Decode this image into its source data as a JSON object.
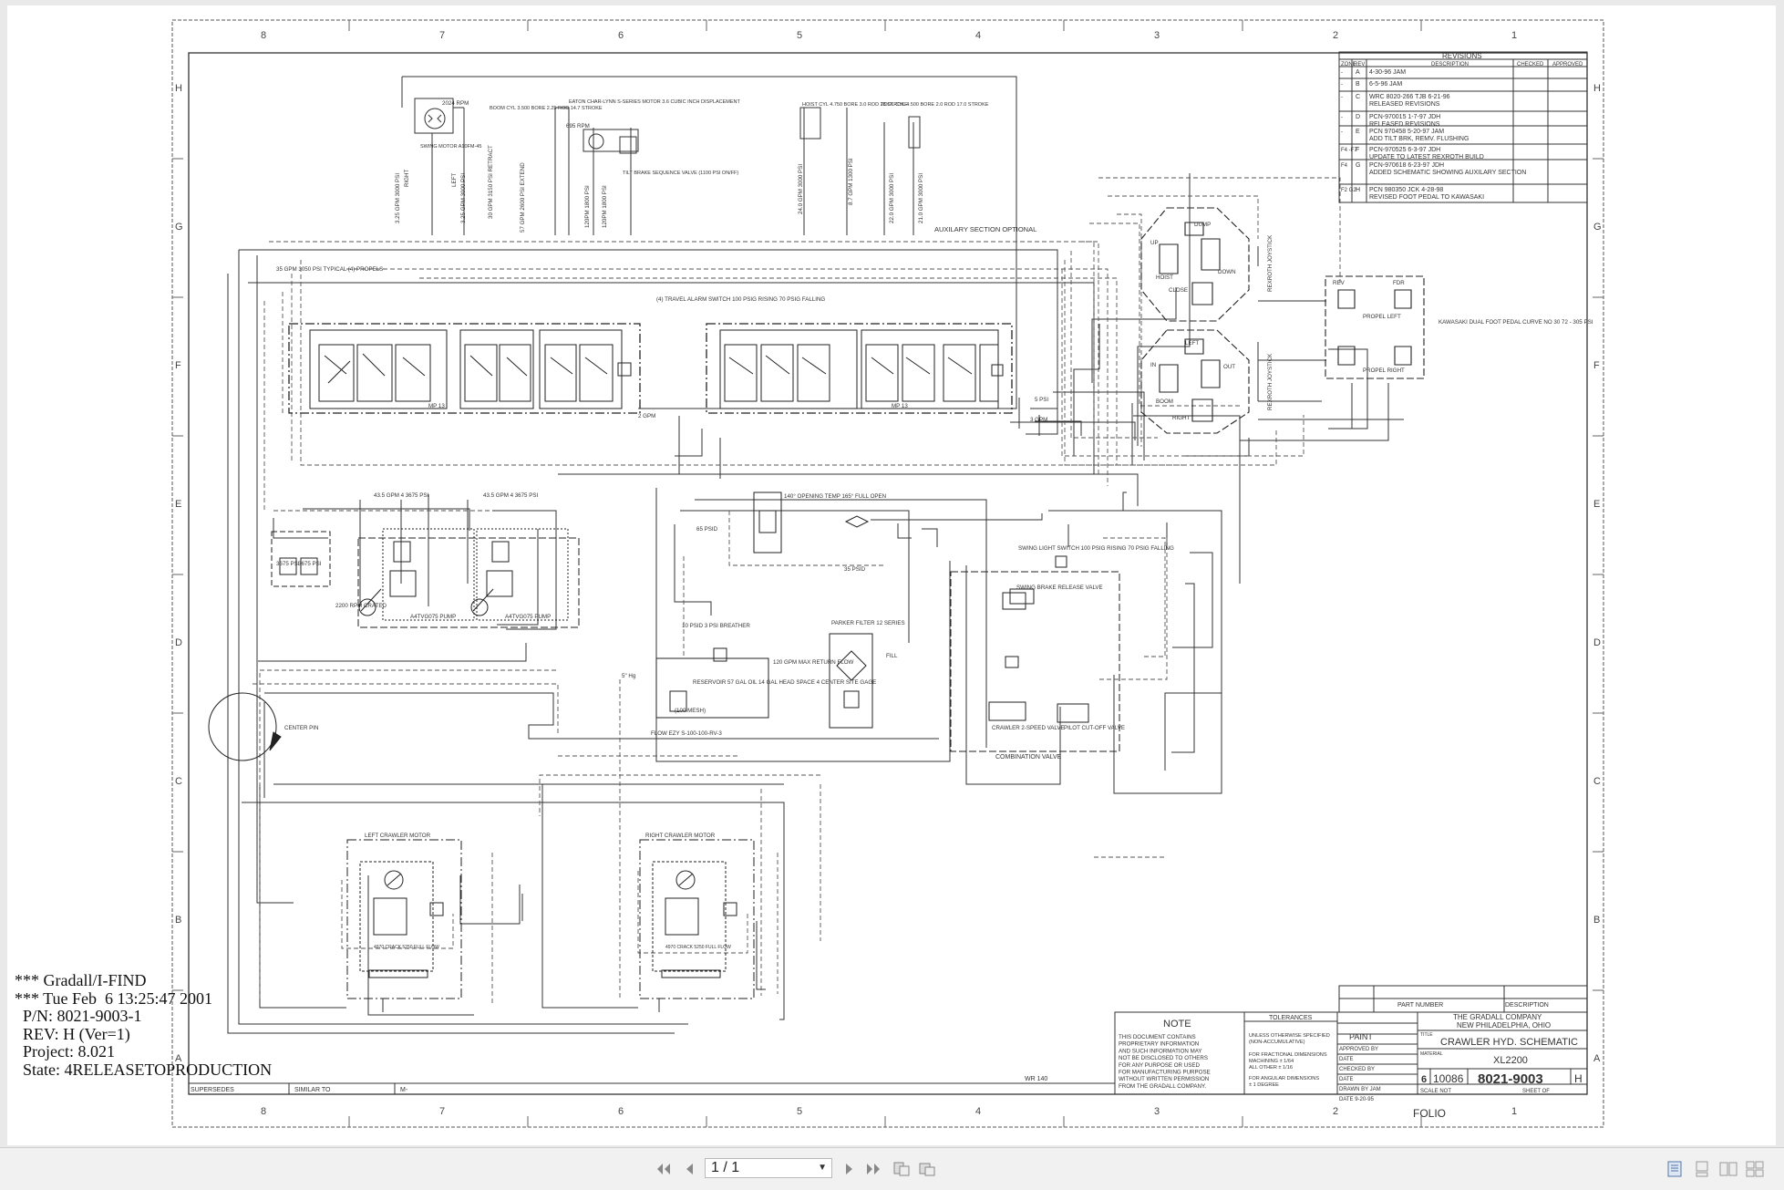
{
  "drawing": {
    "zone_numbers": [
      "8",
      "7",
      "6",
      "5",
      "4",
      "3",
      "2",
      "1"
    ],
    "zone_letters": [
      "H",
      "G",
      "F",
      "E",
      "D",
      "C",
      "B",
      "A"
    ],
    "revisions": {
      "title": "REVISIONS",
      "headers": [
        "ZONE",
        "REV",
        "DESCRIPTION",
        "CHECKED",
        "APPROVED"
      ],
      "rows": [
        {
          "zone": "-",
          "rev": "A",
          "desc1": "4-30-96   JAM",
          "desc2": ""
        },
        {
          "zone": "-",
          "rev": "B",
          "desc1": "6-5-96   JAM",
          "desc2": ""
        },
        {
          "zone": "-",
          "rev": "C",
          "desc1": "WRC 8020-266  TJB  6-21-96",
          "desc2": "RELEASED REVISIONS"
        },
        {
          "zone": "-",
          "rev": "D",
          "desc1": "PCN-970015  1-7-97  JDH",
          "desc2": "RELEASED REVISIONS"
        },
        {
          "zone": "-",
          "rev": "E",
          "desc1": "PCN 970458  5-20-97  JAM",
          "desc2": "ADD TILT BRK, REMV. FLUSHING"
        },
        {
          "zone": "F4 -F7",
          "rev": "F",
          "desc1": "PCN-970525  6-3-97  JDH",
          "desc2": "UPDATE TO LATEST REXROTH BUILD"
        },
        {
          "zone": "F4",
          "rev": "G",
          "desc1": "PCN-970618  6-23-97  JDH",
          "desc2": "ADDED SCHEMATIC SHOWING AUXILARY SECTION"
        },
        {
          "zone": "F2 G2",
          "rev": "H",
          "desc1": "PCN 980350    JCK  4-28-98",
          "desc2": "REVISED FOOT PEDAL TO KAWASAKI"
        }
      ]
    },
    "labels": {
      "rpm_2024": "2024 RPM",
      "swing_motor": "SWING MOTOR A10FM-45",
      "right": "RIGHT",
      "left": "LEFT",
      "swing_flow_r": "3.25 GPM 3000 PSI",
      "swing_flow_l": "3.25 GPM 3000 PSI",
      "boom_cyl": "BOOM CYL 3.500 BORE 2.25 ROD 14.7 STROKE",
      "boom_retract": "30 GPM 3150 PSI RETRACT",
      "boom_extend": "57 GPM 2600 PSI EXTEND",
      "eaton_motor": "EATON CHAR-LYNN S-SERIES MOTOR 3.6 CUBIC INCH DISPLACEMENT",
      "rpm_695": "695 RPM",
      "tilt_brake": "TILT BRAKE SEQUENCE VALVE (1100 PSI ON/FF)",
      "tilt_flow1": "120PM 1800 PSI",
      "tilt_flow2": "120PM 1800 PSI",
      "hoist_cyl": "HOIST CYL 4.750 BORE 3.0 ROD 28 STROKE",
      "tool_cyl": "TOOL CYL 4.500 BORE 2.0 ROD 17.0 STROKE",
      "hoist_flow1": "24.0 GPM 3000 PSI",
      "hoist_flow2": "8.7 GPM 1300 PSI",
      "tool_flow1": "22.0 GPM 3000 PSI",
      "tool_flow2": "21.0 GPM 3000 PSI",
      "aux": "AUXILARY SECTION OPTIONAL",
      "propels": "35 GPM 3050 PSI TYPICAL (4) PROPELS",
      "travel_alarm": "(4) TRAVEL ALARM SWITCH 100 PSIG RISING 70 PSIG FALLING",
      "mp13_a": "MP 13",
      "mp13_b": "MP 13",
      "gpm2": "2 GPM",
      "gpm3": "3 GPM",
      "psi5": "5 PSI",
      "pump_flow1": "43.5 GPM 4 3675 PSI",
      "pump_flow2": "43.5 GPM 4 3675 PSI",
      "rpm_2200": "2200 RPM CRATED",
      "pump_name1": "A4TVG075 PUMP",
      "pump_name2": "A4TVG075 PUMP",
      "psi3675a": "3675 PSI",
      "psi3675b": "3675 PSI",
      "thermo": "140° OPENING TEMP 165° FULL OPEN",
      "psi65": "65 PSID",
      "psi35": "35 PSID",
      "swing_light": "SWING LIGHT SWITCH 100 PSIG RISING 70 PSIG FALLING",
      "swing_brake": "SWING BRAKE RELEASE VALVE",
      "breather": "10 PSID 3 PSI BREATHER",
      "reservoir": "RESERVOIR 57 GAL OIL 14 GAL HEAD SPACE 4 CENTER SITE GAGE",
      "return_flow": "120 GPM MAX RETURN FLOW",
      "filter": "PARKER FILTER 12 SERIES",
      "fill": "FILL",
      "hg": "5\" Hg",
      "mesh": "(100 MESH)",
      "flow_ezy": "FLOW EZY S-100-100-RV-3",
      "center_pin": "CENTER PIN",
      "crawler_2speed": "CRAWLER 2-SPEED VALVE",
      "pilot_cutoff": "PILOT CUT-OFF VALVE",
      "combination": "COMBINATION VALVE",
      "hoist": "HOIST",
      "boom": "BOOM",
      "down": "DOWN",
      "up": "UP",
      "close": "CLOSE",
      "dump": "DUMP",
      "in": "IN",
      "out": "OUT",
      "right_s": "RIGHT",
      "left_s": "LEFT",
      "joystick1": "REXROTH JOYSTICK",
      "joystick2": "REXROTH JOYSTICK",
      "kawasaki": "KAWASAKI DUAL FOOT PEDAL CURVE NO 30 72 - 305 PSI",
      "propel_left": "PROPEL LEFT",
      "propel_right": "PROPEL RIGHT",
      "rev": "REV",
      "fdr": "FDR",
      "left_motor": "LEFT CRAWLER MOTOR",
      "right_motor": "RIGHT CRAWLER MOTOR",
      "motor_crack1": "4970 CRACK 5250 FULL FLOW",
      "motor_crack2": "4970 CRACK 5250 FULL FLOW"
    },
    "title_block": {
      "part_number_hdr": "PART NUMBER",
      "description_hdr": "DESCRIPTION",
      "note_hdr": "NOTE",
      "note_text": [
        "THIS DOCUMENT CONTAINS",
        "PROPRIETARY INFORMATION",
        "AND SUCH INFORMATION MAY",
        "NOT BE DISCLOSED TO OTHERS",
        "FOR ANY PURPOSE OR USED",
        "FOR MANUFACTURING PURPOSE",
        "WITHOUT WRITTEN PERMISSION",
        "FROM THE GRADALL COMPANY."
      ],
      "tolerances_hdr": "TOLERANCES",
      "tol_text": [
        "UNLESS OTHERWISE SPECIFIED",
        "(NON-ACCUMULATIVE)",
        "FOR FRACTIONAL DIMENSIONS",
        "MACHINING    ± 1/64",
        "ALL OTHER    ± 1/16",
        "FOR ANGULAR DIMENSIONS",
        "± 1 DEGREE"
      ],
      "paint": "PAINT",
      "approved_by": "APPROVED BY",
      "date1": "DATE",
      "checked_by": "CHECKED BY",
      "date2": "DATE",
      "drawn_by": "DRAWN BY JAM",
      "date3": "DATE 9-20-95",
      "company1": "THE GRADALL COMPANY",
      "company2": "NEW PHILADELPHIA, OHIO",
      "title_lbl": "TITLE",
      "title": "CRAWLER HYD. SCHEMATIC",
      "material_lbl": "MATERIAL",
      "model": "XL2200",
      "size": "6",
      "cage": "10086",
      "dwg_no": "8021-9003",
      "rev": "H",
      "scale": "SCALE   NOT",
      "sheet": "SHEET   OF",
      "folio": "FOLIO",
      "wr": "WR 140",
      "supersedes": "SUPERSEDES",
      "similar_to": "SIMILAR TO",
      "m": "M-"
    }
  },
  "stamp": {
    "line1": "*** Gradall/I-FIND",
    "line2": "*** Tue Feb  6 13:25:47 2001",
    "line3": "  P/N: 8021-9003-1",
    "line4": "  REV: H (Ver=1)",
    "line5": "  Project: 8.021",
    "line6": "  State: 4RELEASETOPRODUCTION"
  },
  "toolbar": {
    "page_value": "1 / 1",
    "icons": [
      "first-page-icon",
      "prev-page-icon",
      "next-page-icon",
      "last-page-icon",
      "rotate-icon",
      "fit-icon",
      "single-page-icon",
      "two-page-icon",
      "continuous-icon",
      "facing-icon"
    ]
  },
  "colors": {
    "ink": "#222222",
    "paper": "#ffffff",
    "viewer_bg": "#e9e9e9"
  }
}
